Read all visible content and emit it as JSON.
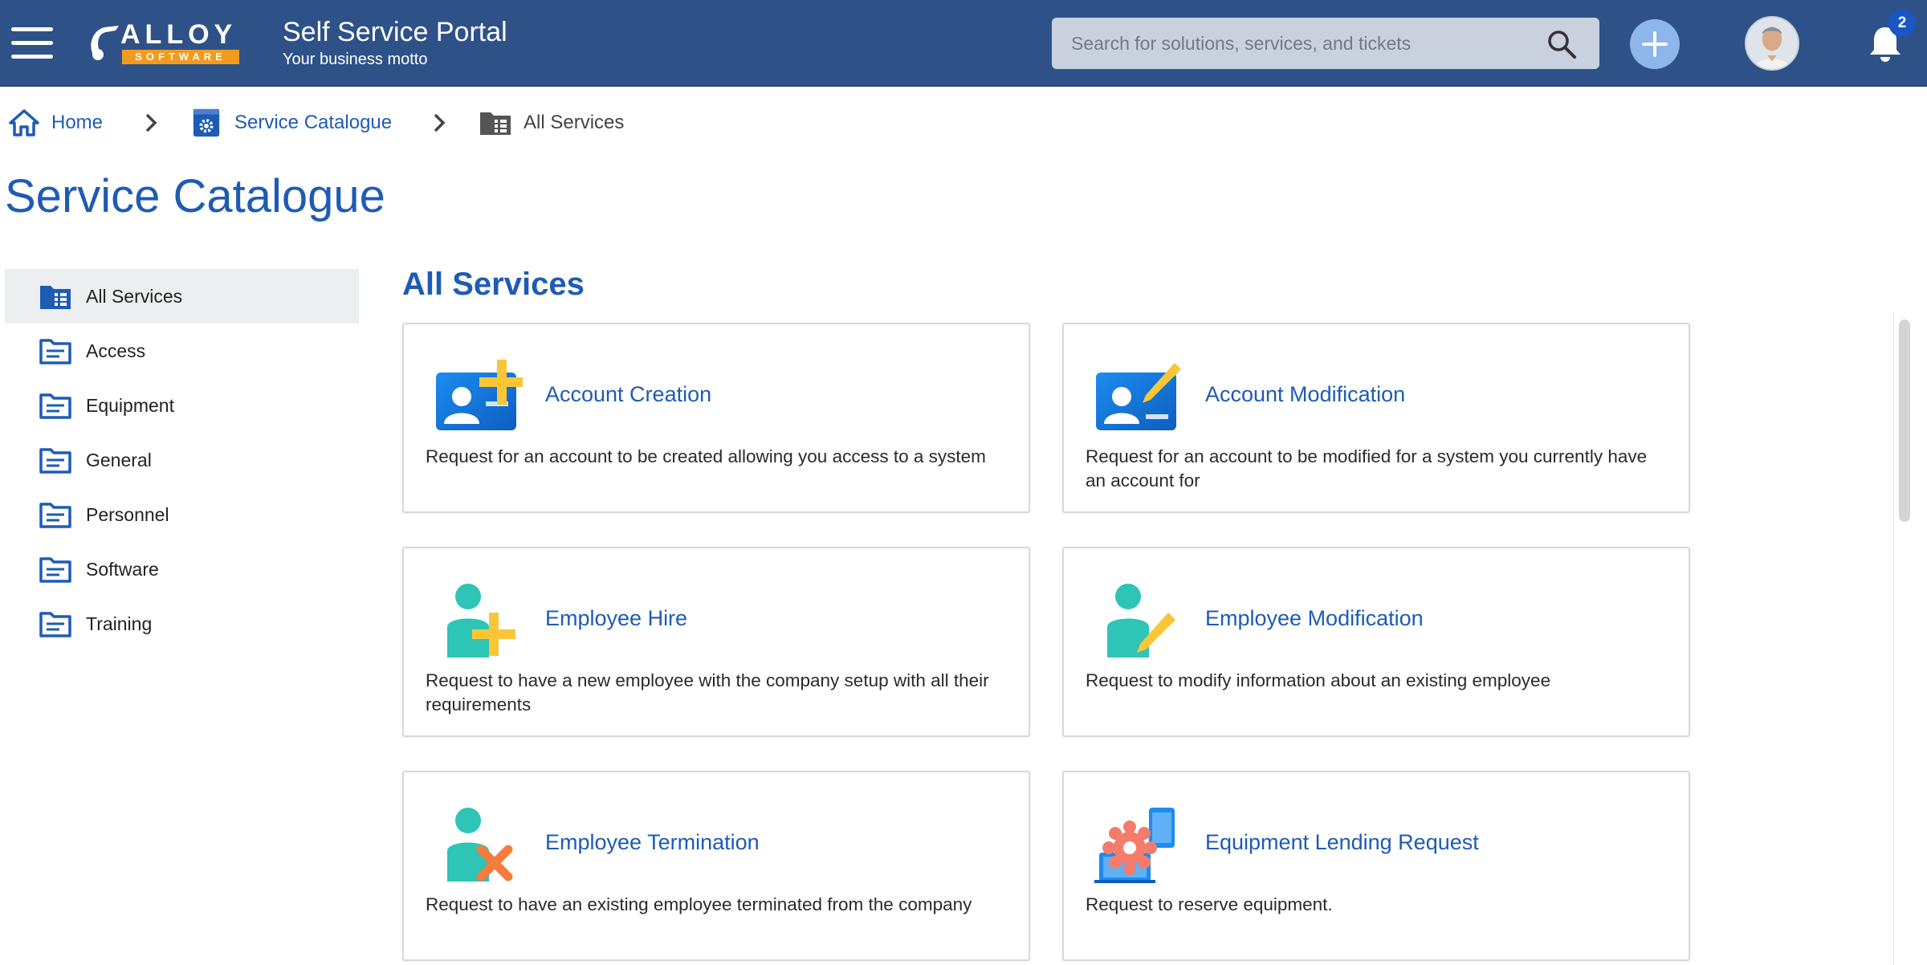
{
  "header": {
    "logo_text": "ALLOY",
    "logo_subtext": "SOFTWARE",
    "title": "Self Service Portal",
    "motto": "Your business motto",
    "search_placeholder": "Search for solutions, services, and tickets",
    "notification_count": "2"
  },
  "breadcrumb": {
    "home": "Home",
    "catalogue": "Service Catalogue",
    "current": "All Services"
  },
  "page_title": "Service Catalogue",
  "sidebar": {
    "items": [
      {
        "label": "All Services"
      },
      {
        "label": "Access"
      },
      {
        "label": "Equipment"
      },
      {
        "label": "General"
      },
      {
        "label": "Personnel"
      },
      {
        "label": "Software"
      },
      {
        "label": "Training"
      }
    ]
  },
  "main": {
    "section_title": "All Services",
    "cards": [
      {
        "title": "Account Creation",
        "description": "Request for an account to be created allowing you access to a system",
        "icon": "account-creation-icon"
      },
      {
        "title": "Account Modification",
        "description": "Request for an account to be modified for a system you currently have an account for",
        "icon": "account-modification-icon"
      },
      {
        "title": "Employee Hire",
        "description": "Request to have a new employee with the company setup with all their requirements",
        "icon": "employee-hire-icon"
      },
      {
        "title": "Employee Modification",
        "description": "Request to modify information about an existing employee",
        "icon": "employee-modification-icon"
      },
      {
        "title": "Employee Termination",
        "description": "Request to have an existing employee terminated from the company",
        "icon": "employee-termination-icon"
      },
      {
        "title": "Equipment Lending Request",
        "description": "Request to reserve equipment.",
        "icon": "equipment-lending-icon"
      }
    ]
  },
  "colors": {
    "header_bg": "#2e5288",
    "accent_blue": "#1e5bb5",
    "logo_orange": "#f39b1e",
    "icon_yellow": "#f9c638",
    "icon_teal": "#2ec4b6",
    "icon_orange": "#f47c3c"
  }
}
